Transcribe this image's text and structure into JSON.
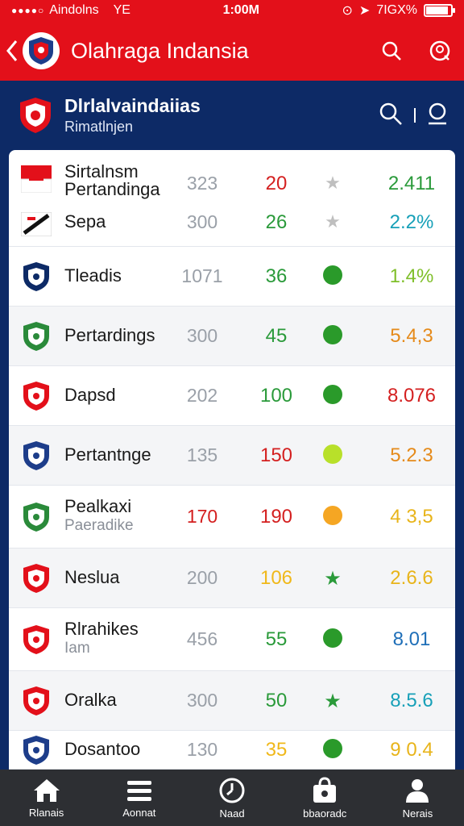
{
  "status_bar": {
    "carrier": "Aindolns",
    "network": "YE",
    "time": "1:00M",
    "battery_text": "7IGX%",
    "battery_level": 0.9
  },
  "app_bar": {
    "title": "Olahraga Indansia"
  },
  "sub_header": {
    "title": "Dlrlalvaindaiias",
    "subtitle": "Rimatlnjen"
  },
  "rows": [
    {
      "names": [
        "Sirtalnsm Pertandinga",
        "Sepa"
      ],
      "a": [
        "323",
        "300"
      ],
      "b": [
        "20",
        "26"
      ],
      "b_colors": [
        "#d42020",
        "#2a9a3a"
      ],
      "marker": "star",
      "marker_color": "#bfbfbf",
      "d": [
        "2.411",
        "2.2%"
      ],
      "d_colors": [
        "#2a9a3a",
        "#17a0b8"
      ]
    },
    {
      "name": "Tleadis",
      "a": "1071",
      "b": "36",
      "b_color": "#2a9a3a",
      "marker": "dot",
      "marker_color": "#2a9a2a",
      "d": "1.4%",
      "d_color": "#7fbf2a"
    },
    {
      "name": "Pertardings",
      "a": "300",
      "b": "45",
      "b_color": "#2a9a3a",
      "marker": "dot",
      "marker_color": "#2a9a2a",
      "d": "5.4,3",
      "d_color": "#e58a1a"
    },
    {
      "name": "Dapsd",
      "a": "202",
      "b": "100",
      "b_color": "#2a9a3a",
      "marker": "dot",
      "marker_color": "#2a9a2a",
      "d": "8.076",
      "d_color": "#d42020"
    },
    {
      "name": "Pertantnge",
      "a": "135",
      "b": "150",
      "b_color": "#d42020",
      "marker": "dot",
      "marker_color": "#b8e02a",
      "d": "5.2.3",
      "d_color": "#e58a1a"
    },
    {
      "name": "Pealkaxi",
      "sub": "Paeradike",
      "a": "170",
      "a_color": "#d42020",
      "b": "190",
      "b_color": "#d42020",
      "marker": "dot",
      "marker_color": "#f5a623",
      "d": "4 3,5",
      "d_color": "#e8b41a"
    },
    {
      "name": "Neslua",
      "a": "200",
      "b": "106",
      "b_color": "#f0b81a",
      "marker": "star",
      "marker_color": "#2a9a3a",
      "d": "2.6.6",
      "d_color": "#e8b41a"
    },
    {
      "name": "Rlrahikes",
      "sub": "Iam",
      "a": "456",
      "b": "55",
      "b_color": "#2a9a3a",
      "marker": "dot",
      "marker_color": "#2a9a2a",
      "d": "8.01",
      "d_color": "#1f6fb8"
    },
    {
      "name": "Oralka",
      "a": "300",
      "b": "50",
      "b_color": "#2a9a3a",
      "marker": "star",
      "marker_color": "#2a9a3a",
      "d": "8.5.6",
      "d_color": "#17a0b8"
    },
    {
      "name": "Dosantoo",
      "a": "130",
      "b": "35",
      "b_color": "#f0b81a",
      "marker": "dot",
      "marker_color": "#2a9a2a",
      "d": "9 0.4",
      "d_color": "#e8b41a"
    }
  ],
  "bottom_nav": [
    {
      "label": "Rlanais",
      "icon": "home-icon"
    },
    {
      "label": "Aonnat",
      "icon": "menu-icon"
    },
    {
      "label": "Naad",
      "icon": "clock-icon"
    },
    {
      "label": "bbaoradc",
      "icon": "bag-icon"
    },
    {
      "label": "Nerais",
      "icon": "person-icon"
    }
  ]
}
